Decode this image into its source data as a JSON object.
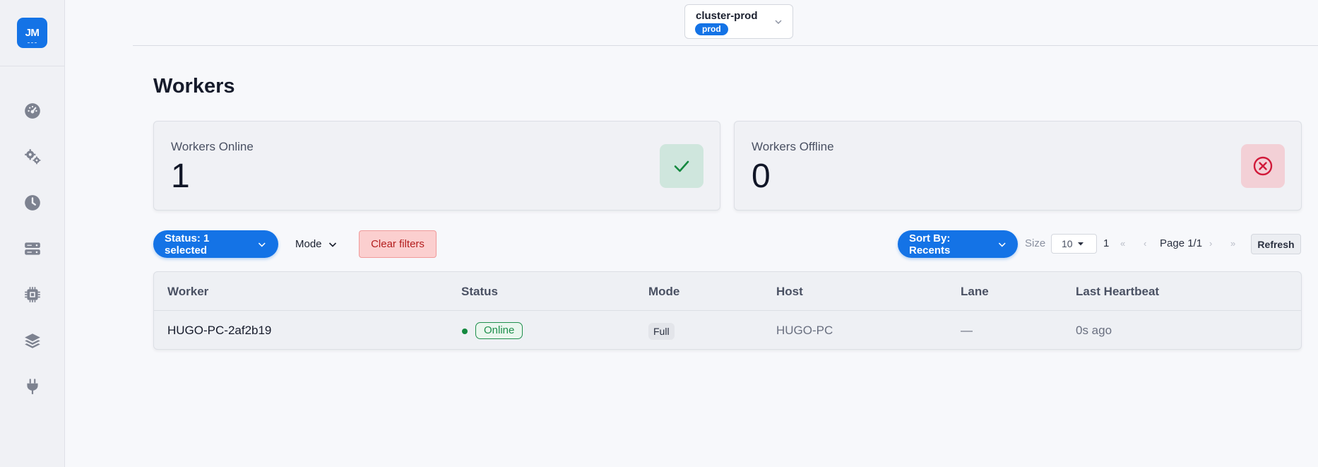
{
  "sidebar": {
    "logo": "JM",
    "items": [
      {
        "icon": "dashboard-gauge-icon"
      },
      {
        "icon": "gears-icon"
      },
      {
        "icon": "clock-icon"
      },
      {
        "icon": "server-icon"
      },
      {
        "icon": "cpu-chip-icon"
      },
      {
        "icon": "layers-icon"
      },
      {
        "icon": "plug-icon"
      }
    ]
  },
  "topbar": {
    "cluster_name": "cluster-prod",
    "cluster_env": "prod"
  },
  "page": {
    "title": "Workers"
  },
  "stats": {
    "online": {
      "label": "Workers Online",
      "value": "1",
      "color": "#14893f"
    },
    "offline": {
      "label": "Workers Offline",
      "value": "0",
      "color": "#d11a3a"
    }
  },
  "filters": {
    "status_label": "Status: 1 selected",
    "mode_label": "Mode",
    "clear_label": "Clear filters",
    "sort_label": "Sort By: Recents",
    "size_label": "Size",
    "size_value": "10",
    "page_number": "1",
    "page_text": "Page 1/1",
    "refresh_label": "Refresh",
    "first_arrow": "«",
    "prev_arrow": "‹",
    "next_arrow": "›",
    "last_arrow": "»"
  },
  "table": {
    "columns": [
      "Worker",
      "Status",
      "Mode",
      "Host",
      "Lane",
      "Last Heartbeat"
    ],
    "rows": [
      {
        "worker": "HUGO-PC-2af2b19",
        "status": "Online",
        "mode": "Full",
        "host": "HUGO-PC",
        "lane": "—",
        "last_heartbeat": "0s ago"
      }
    ]
  },
  "colors": {
    "accent": "#1473e6",
    "online": "#1e8f4c",
    "danger": "#d11a3a"
  }
}
